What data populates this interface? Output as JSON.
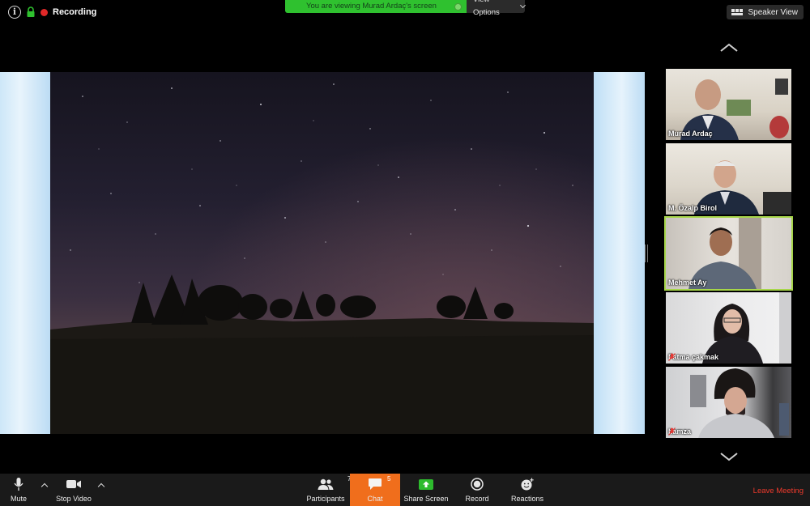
{
  "window": {
    "recording_label": "Recording",
    "share_banner_text": "You are viewing Murad Ardaç's screen",
    "view_options_label": "View Options",
    "speaker_view_label": "Speaker View"
  },
  "participants": [
    {
      "name": "Murad Ardaç",
      "muted": false,
      "active": false
    },
    {
      "name": "M. Özalp Birol",
      "muted": false,
      "active": false
    },
    {
      "name": "Mehmet Ay",
      "muted": false,
      "active": true
    },
    {
      "name": "Fatma çakmak",
      "muted": true,
      "active": false
    },
    {
      "name": "hamza",
      "muted": true,
      "active": false
    }
  ],
  "toolbar": {
    "mute_label": "Mute",
    "stop_video_label": "Stop Video",
    "participants_label": "Participants",
    "participants_count": "70",
    "chat_label": "Chat",
    "chat_count": "5",
    "share_screen_label": "Share Screen",
    "record_label": "Record",
    "reactions_label": "Reactions",
    "leave_label": "Leave Meeting"
  },
  "colors": {
    "banner_green": "#2fc12f",
    "chat_orange": "#f06e1c",
    "leave_red": "#ee3a2c",
    "active_outline": "#a7d64a",
    "share_green": "#2dbb2d"
  },
  "icons": [
    "info-icon",
    "lock-icon",
    "record-dot-icon",
    "grid-icon",
    "chevron-up-icon",
    "chevron-down-icon",
    "microphone-icon",
    "video-camera-icon",
    "participants-icon",
    "chat-icon",
    "share-screen-icon",
    "record-icon",
    "reactions-icon",
    "muted-mic-icon"
  ]
}
